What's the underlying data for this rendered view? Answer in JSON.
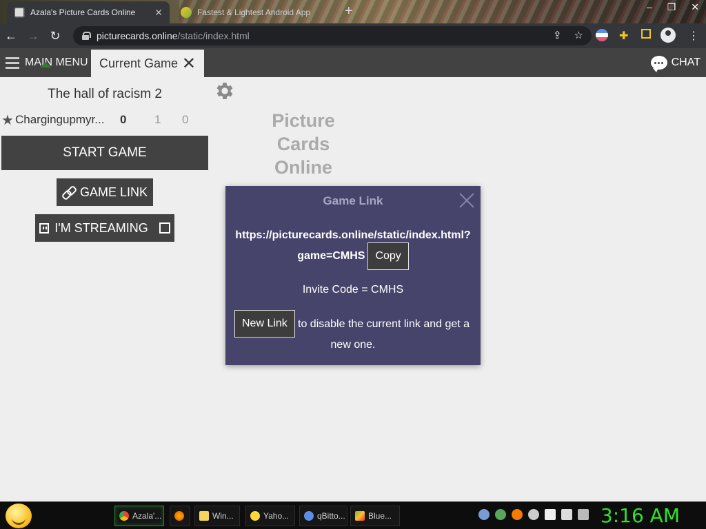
{
  "browser": {
    "tabs": [
      {
        "title": "Azala's Picture Cards Online",
        "active": true
      },
      {
        "title": "Fastest & Lightest Android App",
        "active": false
      }
    ],
    "url_host": "picturecards.online",
    "url_path": "/static/index.html"
  },
  "header": {
    "main_menu_label": "MAIN MENU",
    "current_tab_label": "Current Game",
    "chat_label": "CHAT"
  },
  "game": {
    "title": "The hall of racism 2",
    "player": {
      "name": "Chargingupmyr...",
      "score": "0",
      "col1": "1",
      "col2": "0"
    },
    "start_label": "START GAME",
    "game_link_label": "GAME LINK",
    "streaming_label": "I'M STREAMING"
  },
  "logo": {
    "line1": "Picture",
    "line2": "Cards",
    "line3": "Online"
  },
  "modal": {
    "title": "Game Link",
    "link_line1": "https://picturecards.online/static/index.html?",
    "link_line2": "game=CMHS",
    "copy_label": "Copy",
    "invite_text": "Invite Code = CMHS",
    "new_link_label": "New Link",
    "new_link_desc1": "to disable the current link and get a",
    "new_link_desc2": "new one."
  },
  "taskbar": {
    "items": [
      "Azala'...",
      "Win...",
      "Yaho...",
      "qBitto...",
      "Blue..."
    ],
    "clock": "3:16 AM"
  },
  "colors": {
    "modal_bg": "#47446b",
    "appbar_bg": "#424242",
    "clock_green": "#2ee32e"
  }
}
